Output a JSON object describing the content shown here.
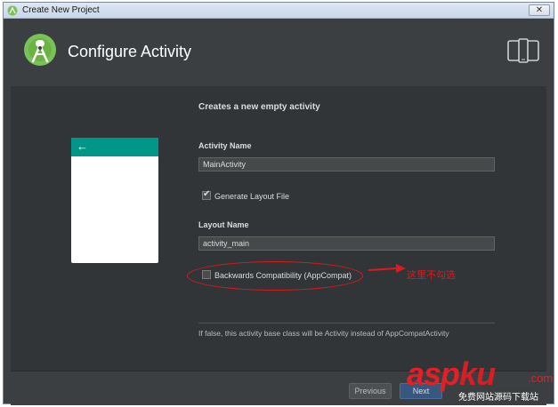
{
  "window": {
    "title": "Create New Project",
    "close_glyph": "✕"
  },
  "header": {
    "heading": "Configure Activity",
    "logo_icon": "android-studio-logo",
    "device_icon": "phone-tablet-icon"
  },
  "content": {
    "subtitle": "Creates a new empty activity",
    "activity_name_label": "Activity Name",
    "activity_name_value": "MainActivity",
    "generate_layout_label": "Generate Layout File",
    "generate_layout_checked": true,
    "layout_name_label": "Layout Name",
    "layout_name_value": "activity_main",
    "backwards_label": "Backwards Compatibility (AppCompat)",
    "backwards_checked": false,
    "annotation": "这里不勾选",
    "hint": "If false, this activity base class will be Activity instead of AppCompatActivity",
    "preview_back_glyph": "←"
  },
  "footer": {
    "previous_label": "Previous",
    "next_label": "Next"
  },
  "watermark": {
    "main_asp": "asp",
    "main_ku": "ku",
    "dot": ".com",
    "sub": "免费网站源码下载站"
  },
  "colors": {
    "accent": "#009688",
    "annotation": "#e0191d",
    "primary_button": "#365880"
  }
}
